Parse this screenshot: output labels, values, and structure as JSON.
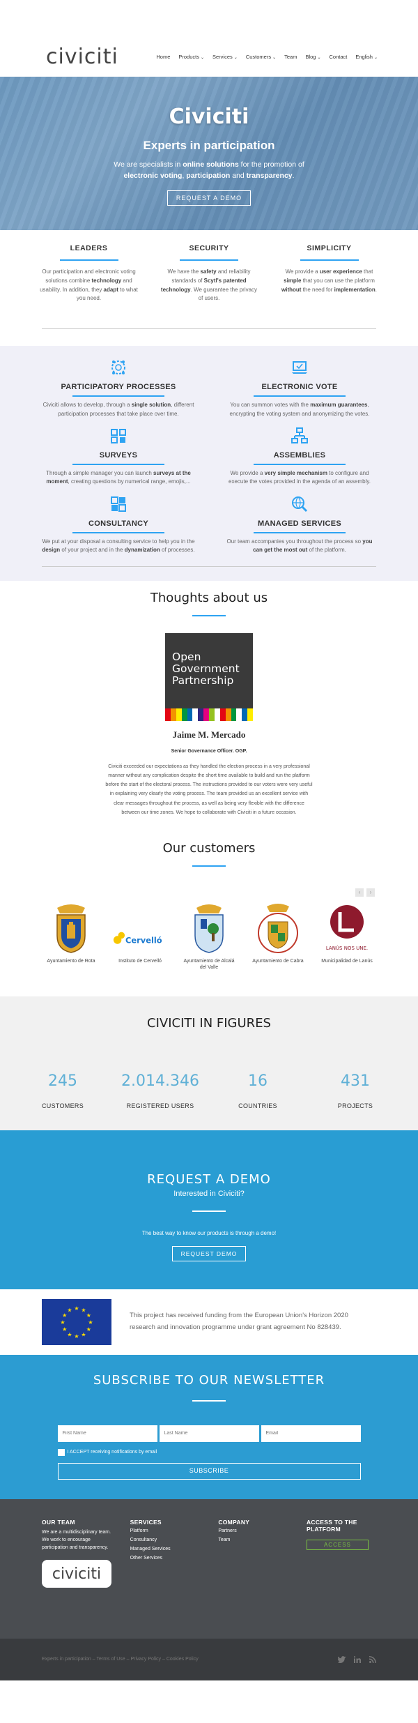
{
  "header": {
    "logo_text": "civiciti",
    "nav": [
      {
        "label": "Home",
        "active": true,
        "has_menu": false
      },
      {
        "label": "Products",
        "active": false,
        "has_menu": true
      },
      {
        "label": "Services",
        "active": false,
        "has_menu": true
      },
      {
        "label": "Customers",
        "active": false,
        "has_menu": true
      },
      {
        "label": "Team",
        "active": false,
        "has_menu": false
      },
      {
        "label": "Blog",
        "active": false,
        "has_menu": true
      },
      {
        "label": "Contact",
        "active": false,
        "has_menu": false
      },
      {
        "label": "English",
        "active": false,
        "has_menu": true
      }
    ]
  },
  "hero": {
    "title": "Civiciti",
    "subtitle": "Experts in participation",
    "text_parts": [
      "We are specialists in ",
      "online solutions",
      " for the promotion of ",
      "electronic voting",
      ", ",
      "participation",
      " and ",
      "transparency",
      "."
    ],
    "button_label": "REQUEST A DEMO"
  },
  "pillars": [
    {
      "title": "LEADERS",
      "text": "Our participation and electronic voting solutions combine technology and usability. In addition, they adapt to what you need."
    },
    {
      "title": "SECURITY",
      "text": "We have the safety and reliability standards of Scytl's patented technology. We guarantee the privacy of users."
    },
    {
      "title": "SIMPLICITY",
      "text": "We provide a user experience that simple that you can use the platform without the need for implementation."
    }
  ],
  "services": [
    {
      "title": "PARTICIPATORY PROCESSES",
      "icon": "gears-people-icon",
      "text": "Civiciti allows to develop, through a single solution, different participation processes that take place over time."
    },
    {
      "title": "ELECTRONIC VOTE",
      "icon": "laptop-vote-icon",
      "text": "You can summon votes with the maximum guarantees, encrypting the voting system and anonymizing the votes."
    },
    {
      "title": "SURVEYS",
      "icon": "survey-icon",
      "text": "Through a simple manager you can launch surveys at the moment, creating questions by numerical range, emojis,..."
    },
    {
      "title": "ASSEMBLIES",
      "icon": "network-icon",
      "text": "We provide a very simple mechanism to configure and execute the votes provided in the agenda of an assembly."
    },
    {
      "title": "CONSULTANCY",
      "icon": "consultancy-icon",
      "text": "We put at your disposal a consulting service to help you in the design of your project and in the dynamization of processes."
    },
    {
      "title": "MANAGED SERVICES",
      "icon": "globe-search-icon",
      "text": "Our team accompanies you throughout the process so you can get the most out of the platform."
    }
  ],
  "thoughts": {
    "title": "Thoughts about us",
    "logo_lines": [
      "Open",
      "Government",
      "Partnership"
    ],
    "stripe_colors": [
      "#e30613",
      "#f39200",
      "#ffed00",
      "#009640",
      "#0069b4",
      "#ffffff",
      "#312783",
      "#e6007e",
      "#95c11f",
      "#ffffff",
      "#e30613",
      "#f39200",
      "#009640",
      "#ffffff",
      "#0069b4",
      "#ffed00"
    ],
    "person_name": "Jaime M. Mercado",
    "person_role": "Senior Governance Officer. OGP.",
    "quote": "Civiciti exceeded our expectations as they handled the election process in a very professional manner without any complication despite the short time available to build and run the platform before the start of the electoral process. The instructions provided to our voters were very useful in explaining very clearly the voting process. The team provided us an excellent service with clear messages throughout the process, as well as being very flexible with the difference between our time zones. We hope to collaborate with Civiciti in a future occasion."
  },
  "customers": {
    "title": "Our customers",
    "prev": "‹",
    "next": "›",
    "items": [
      {
        "name": "Ayuntamiento de Rota",
        "logo": "rota-coat-of-arms"
      },
      {
        "name": "Instituto de Cervelló",
        "logo": "cervello-logo",
        "logo_text": "Cervelló"
      },
      {
        "name": "Ayuntamiento de Alcalá del Valle",
        "logo": "alcala-coat-of-arms"
      },
      {
        "name": "Ayuntamiento de Cabra",
        "logo": "cabra-seal"
      },
      {
        "name": "Municipalidad de Lanús",
        "logo": "lanus-logo",
        "logo_text": "LANÚS NOS UNE."
      }
    ]
  },
  "figures": {
    "title": "CIVICITI IN FIGURES",
    "items": [
      {
        "value": "245",
        "label": "CUSTOMERS"
      },
      {
        "value": "2.014.346",
        "label": "REGISTERED USERS"
      },
      {
        "value": "16",
        "label": "COUNTRIES"
      },
      {
        "value": "431",
        "label": "PROJECTS"
      }
    ]
  },
  "demo": {
    "title": "REQUEST A DEMO",
    "subtitle": "Interested in Civiciti?",
    "text": "The best way to know our products is through a demo!",
    "button_label": "REQUEST DEMO"
  },
  "eu": {
    "text": "This project has received funding from the European Union's Horizon 2020 research and innovation programme under grant agreement No 828439."
  },
  "newsletter": {
    "title": "SUBSCRIBE TO OUR NEWSLETTER",
    "first_name_placeholder": "First Name",
    "last_name_placeholder": "Last Name",
    "email_placeholder": "Email",
    "consent_label": "I ACCEPT receiving notifications by email",
    "button_label": "SUBSCRIBE"
  },
  "footer": {
    "team_title": "OUR TEAM",
    "team_text": "We are a multidisciplinary team. We work to encourage participation and transparency.",
    "logo_text": "civiciti",
    "services_title": "SERVICES",
    "services_links": [
      "Platform",
      "Consultancy",
      "Managed Services",
      "Other Services"
    ],
    "company_title": "COMPANY",
    "company_links": [
      "Partners",
      "Team"
    ],
    "access_title": "ACCESS TO THE PLATFORM",
    "access_button": "ACCESS",
    "bottom_links": "Experts in participation – Terms of Use – Privacy Policy – Cookies Policy",
    "social": [
      "twitter-icon",
      "linkedin-icon",
      "rss-icon"
    ]
  },
  "colors": {
    "accent": "#2ea3f2",
    "demo_bg": "#299dd3",
    "footer_bg": "#4a4d51",
    "access_green": "#7ac143",
    "services_bg": "#f0f0f8"
  }
}
